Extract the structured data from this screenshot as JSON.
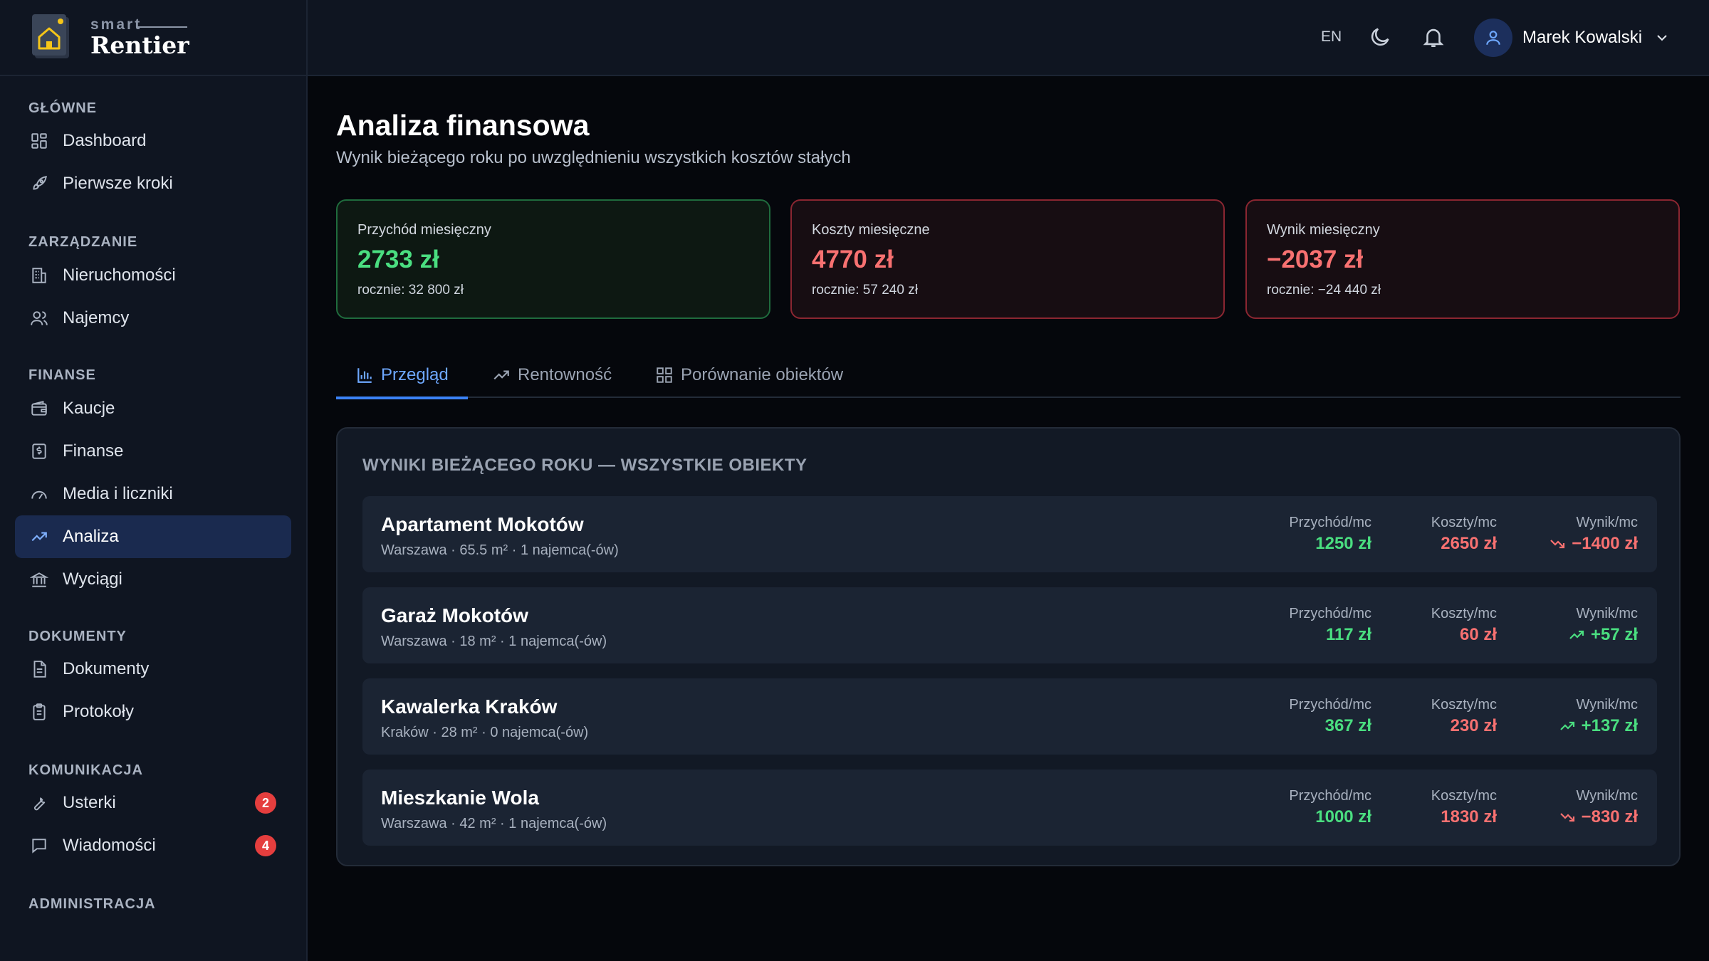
{
  "brand": {
    "small": "smart",
    "big": "Rentier"
  },
  "sidebar": {
    "sections": [
      {
        "title": "GŁÓWNE",
        "items": [
          {
            "label": "Dashboard",
            "icon": "dashboard-icon"
          },
          {
            "label": "Pierwsze kroki",
            "icon": "rocket-icon"
          }
        ]
      },
      {
        "title": "ZARZĄDZANIE",
        "items": [
          {
            "label": "Nieruchomości",
            "icon": "building-icon"
          },
          {
            "label": "Najemcy",
            "icon": "users-icon"
          }
        ]
      },
      {
        "title": "FINANSE",
        "items": [
          {
            "label": "Kaucje",
            "icon": "wallet-icon"
          },
          {
            "label": "Finanse",
            "icon": "dollar-icon"
          },
          {
            "label": "Media i liczniki",
            "icon": "gauge-icon"
          },
          {
            "label": "Analiza",
            "icon": "trend-icon",
            "active": true
          },
          {
            "label": "Wyciągi",
            "icon": "bank-icon"
          }
        ]
      },
      {
        "title": "DOKUMENTY",
        "items": [
          {
            "label": "Dokumenty",
            "icon": "document-icon"
          },
          {
            "label": "Protokoły",
            "icon": "clipboard-icon"
          }
        ]
      },
      {
        "title": "KOMUNIKACJA",
        "items": [
          {
            "label": "Usterki",
            "icon": "wrench-icon",
            "badge": "2"
          },
          {
            "label": "Wiadomości",
            "icon": "message-icon",
            "badge": "4"
          }
        ]
      },
      {
        "title": "ADMINISTRACJA",
        "items": []
      }
    ]
  },
  "header": {
    "lang": "EN",
    "user_name": "Marek Kowalski"
  },
  "page": {
    "title": "Analiza finansowa",
    "subtitle": "Wynik bieżącego roku po uwzględnieniu wszystkich kosztów stałych"
  },
  "stats": [
    {
      "label": "Przychód miesięczny",
      "value": "2733 zł",
      "sub": "rocznie: 32 800 zł",
      "tone": "g"
    },
    {
      "label": "Koszty miesięczne",
      "value": "4770 zł",
      "sub": "rocznie: 57 240 zł",
      "tone": "r"
    },
    {
      "label": "Wynik miesięczny",
      "value": "−2037 zł",
      "sub": "rocznie: −24 440 zł",
      "tone": "r"
    }
  ],
  "tabs": [
    {
      "label": "Przegląd",
      "active": true
    },
    {
      "label": "Rentowność"
    },
    {
      "label": "Porównanie obiektów"
    }
  ],
  "panel": {
    "title": "WYNIKI BIEŻĄCEGO ROKU — WSZYSTKIE OBIEKTY",
    "col_labels": {
      "income": "Przychód/mc",
      "costs": "Koszty/mc",
      "result": "Wynik/mc"
    },
    "properties": [
      {
        "name": "Apartament Mokotów",
        "meta": "Warszawa · 65.5 m² · 1 najemca(-ów)",
        "income": "1250 zł",
        "costs": "2650 zł",
        "result": "−1400 zł",
        "trend": "down"
      },
      {
        "name": "Garaż Mokotów",
        "meta": "Warszawa · 18 m² · 1 najemca(-ów)",
        "income": "117 zł",
        "costs": "60 zł",
        "result": "+57 zł",
        "trend": "up"
      },
      {
        "name": "Kawalerka Kraków",
        "meta": "Kraków · 28 m² · 0 najemca(-ów)",
        "income": "367 zł",
        "costs": "230 zł",
        "result": "+137 zł",
        "trend": "up"
      },
      {
        "name": "Mieszkanie Wola",
        "meta": "Warszawa · 42 m² · 1 najemca(-ów)",
        "income": "1000 zł",
        "costs": "1830 zł",
        "result": "−830 zł",
        "trend": "down"
      }
    ]
  },
  "colors": {
    "positive": "#4ade80",
    "negative": "#f87171",
    "accent": "#3b82f6"
  }
}
